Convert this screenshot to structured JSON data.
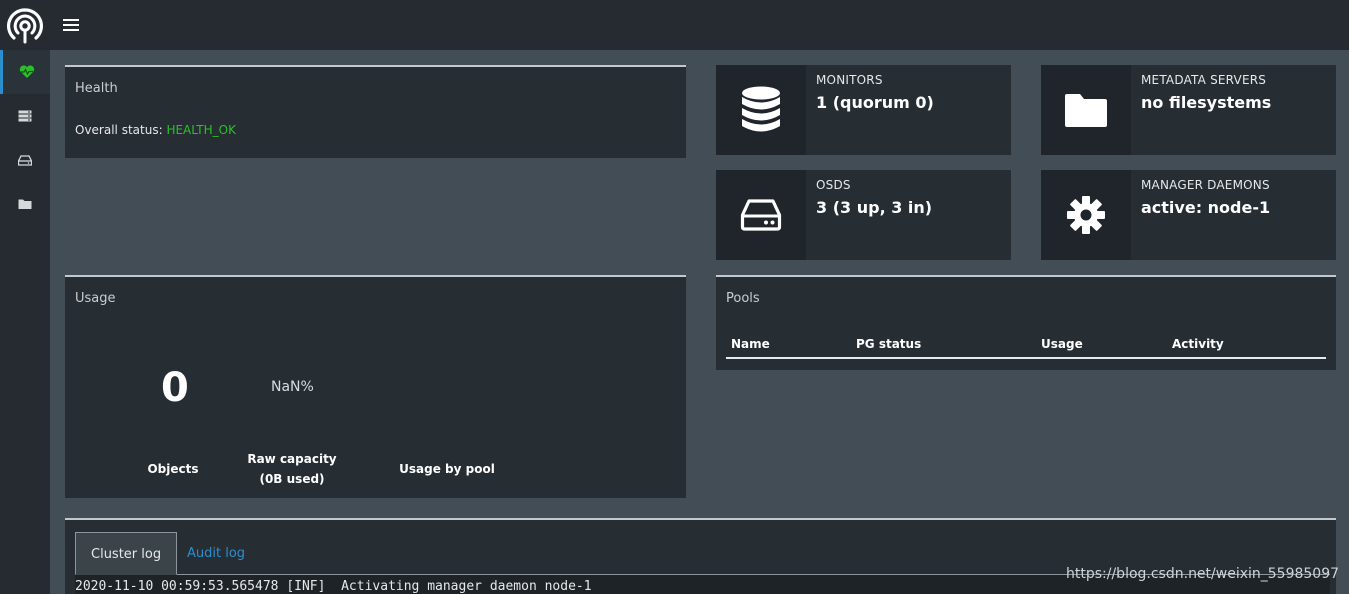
{
  "topbar": {
    "menu_icon": "hamburger-icon"
  },
  "sidebar": {
    "items": [
      {
        "icon": "heartbeat-icon",
        "active": true
      },
      {
        "icon": "server-list-icon",
        "active": false
      },
      {
        "icon": "drive-icon",
        "active": false
      },
      {
        "icon": "folder-icon",
        "active": false
      }
    ]
  },
  "health": {
    "title": "Health",
    "status_label": "Overall status:",
    "status_value": "HEALTH_OK",
    "status_color": "#29c129"
  },
  "monitors": {
    "label": "MONITORS",
    "value": "1 (quorum 0)",
    "icon": "database-icon"
  },
  "metadata_servers": {
    "label": "METADATA SERVERS",
    "value": "no filesystems",
    "icon": "folder-icon"
  },
  "osds": {
    "label": "OSDS",
    "value": "3 (3 up, 3 in)",
    "icon": "drive-icon"
  },
  "manager_daemons": {
    "label": "MANAGER DAEMONS",
    "value": "active: node-1",
    "icon": "gear-icon"
  },
  "usage": {
    "title": "Usage",
    "objects_value": "0",
    "objects_label": "Objects",
    "raw_capacity_percent": "NaN%",
    "raw_capacity_label": "Raw capacity",
    "raw_capacity_used": "(0B used)",
    "usage_by_pool_label": "Usage by pool"
  },
  "pools": {
    "title": "Pools",
    "columns": [
      "Name",
      "PG status",
      "Usage",
      "Activity"
    ]
  },
  "logs": {
    "tabs": [
      {
        "label": "Cluster log",
        "active": true
      },
      {
        "label": "Audit log",
        "active": false
      }
    ],
    "entries": [
      "2020-11-10 00:59:53.565478 [INF]  Activating manager daemon node-1"
    ]
  },
  "watermark": "https://blog.csdn.net/weixin_55985097",
  "colors": {
    "accent": "#2a8fcf",
    "ok": "#29c129",
    "background": "#424d55",
    "panel": "#262d33"
  }
}
